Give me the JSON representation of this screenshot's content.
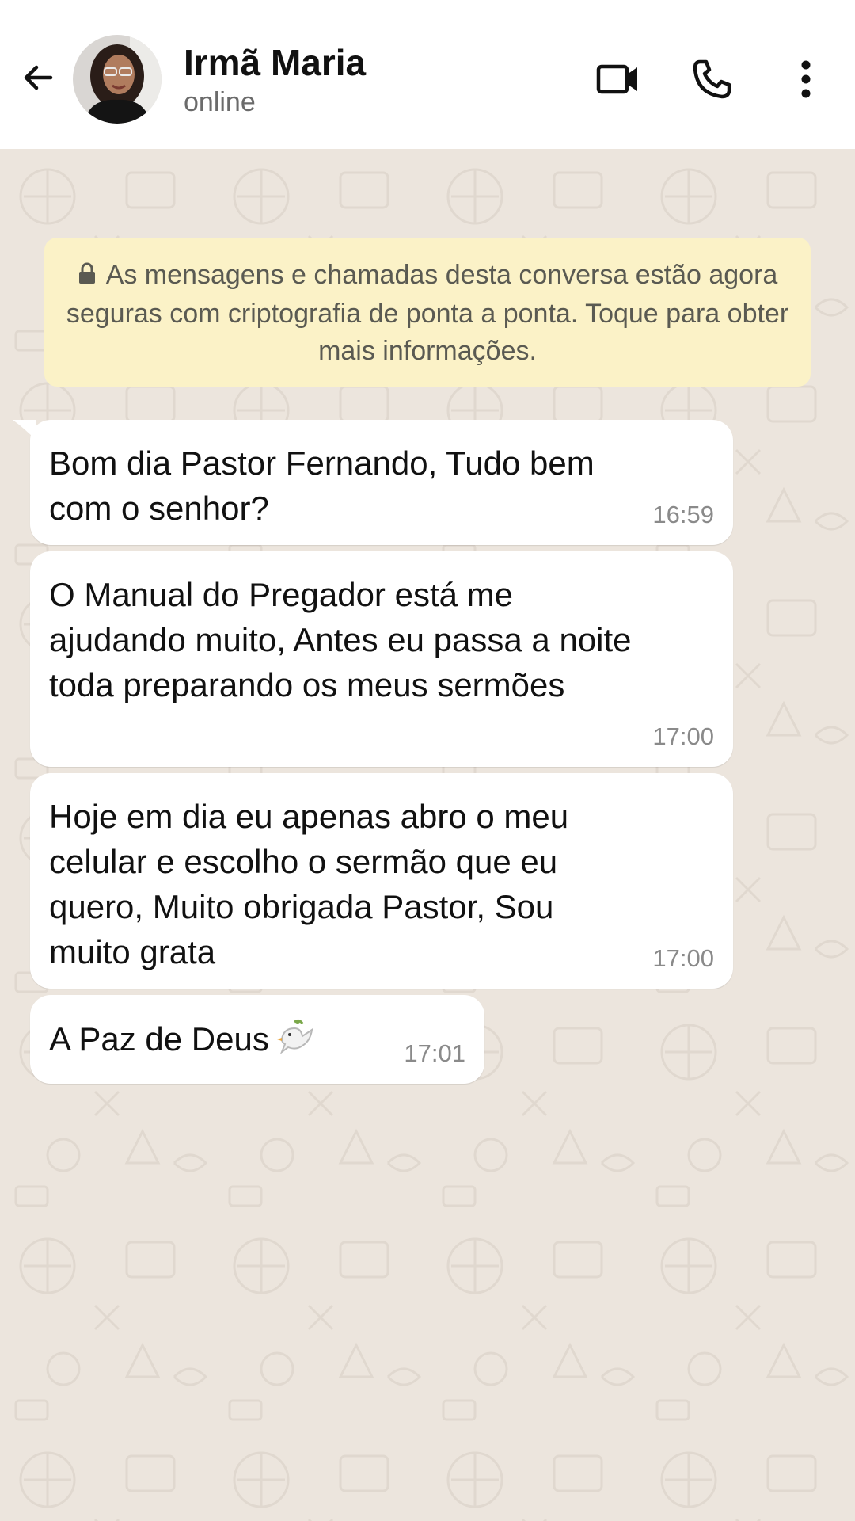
{
  "header": {
    "contact_name": "Irmã Maria",
    "status": "online",
    "icons": {
      "back": "arrow-left-icon",
      "video": "video-camera-icon",
      "call": "phone-icon",
      "menu": "more-vertical-icon"
    }
  },
  "encryption_notice": {
    "text": "As mensagens e chamadas desta conversa estão agora seguras com criptografia de ponta a ponta. Toque para obter mais informações.",
    "icon": "lock-icon"
  },
  "messages": [
    {
      "text": "Bom dia Pastor Fernando, Tudo bem\ncom o senhor?",
      "time": "16:59"
    },
    {
      "text": "O Manual do Pregador está me\najudando muito, Antes eu passa a noite\ntoda preparando os meus sermões",
      "time": "17:00"
    },
    {
      "text": "Hoje em dia eu apenas abro o meu\ncelular e escolho o sermão que eu\nquero, Muito obrigada Pastor, Sou\nmuito grata",
      "time": "17:00"
    },
    {
      "text": "A Paz de Deus",
      "time": "17:01",
      "emoji": "dove-icon"
    }
  ],
  "colors": {
    "header_bg": "#ffffff",
    "chat_bg": "#ece5dd",
    "bubble_bg": "#ffffff",
    "banner_bg": "#fbf2c7"
  }
}
